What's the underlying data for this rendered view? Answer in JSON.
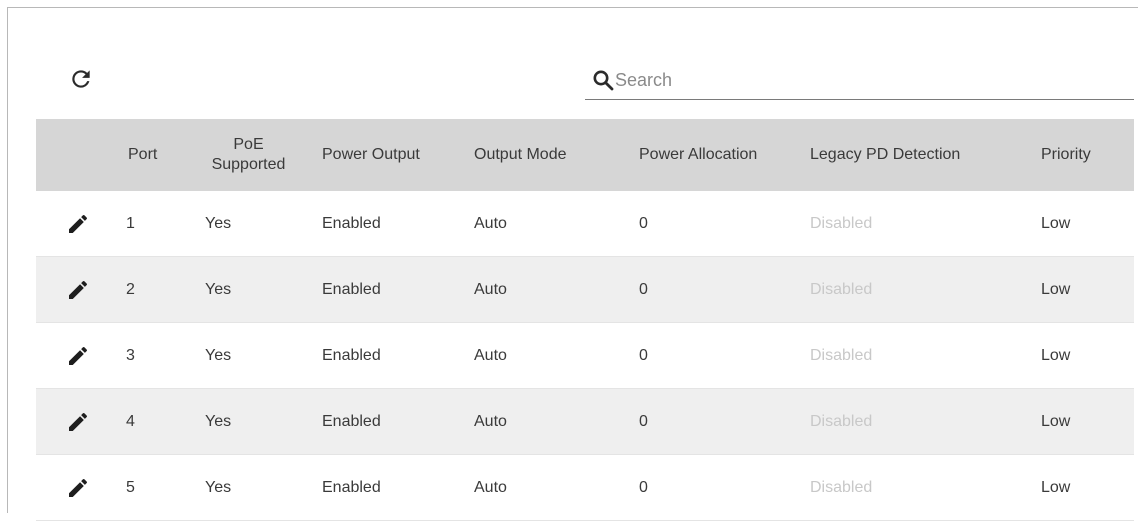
{
  "toolbar": {
    "refresh_icon": "refresh-icon",
    "search_placeholder": "Search",
    "search_value": "",
    "search_icon": "search-icon"
  },
  "table": {
    "columns": [
      {
        "key": "edit",
        "label": ""
      },
      {
        "key": "port",
        "label": "Port"
      },
      {
        "key": "poe_supported",
        "label": "PoE\nSupported"
      },
      {
        "key": "power_output",
        "label": "Power Output"
      },
      {
        "key": "output_mode",
        "label": "Output Mode"
      },
      {
        "key": "power_allocation",
        "label": "Power Allocation"
      },
      {
        "key": "legacy_pd",
        "label": "Legacy PD Detection"
      },
      {
        "key": "priority",
        "label": "Priority"
      }
    ],
    "rows": [
      {
        "port": "1",
        "poe_supported": "Yes",
        "power_output": "Enabled",
        "output_mode": "Auto",
        "power_allocation": "0",
        "legacy_pd": "Disabled",
        "priority": "Low"
      },
      {
        "port": "2",
        "poe_supported": "Yes",
        "power_output": "Enabled",
        "output_mode": "Auto",
        "power_allocation": "0",
        "legacy_pd": "Disabled",
        "priority": "Low"
      },
      {
        "port": "3",
        "poe_supported": "Yes",
        "power_output": "Enabled",
        "output_mode": "Auto",
        "power_allocation": "0",
        "legacy_pd": "Disabled",
        "priority": "Low"
      },
      {
        "port": "4",
        "poe_supported": "Yes",
        "power_output": "Enabled",
        "output_mode": "Auto",
        "power_allocation": "0",
        "legacy_pd": "Disabled",
        "priority": "Low"
      },
      {
        "port": "5",
        "poe_supported": "Yes",
        "power_output": "Enabled",
        "output_mode": "Auto",
        "power_allocation": "0",
        "legacy_pd": "Disabled",
        "priority": "Low"
      }
    ],
    "edit_icon": "pencil-icon"
  },
  "colors": {
    "header_bg": "#d6d6d6",
    "stripe_bg": "#efefef",
    "disabled_text": "#c8c8c8",
    "text": "#3a3a3a"
  }
}
